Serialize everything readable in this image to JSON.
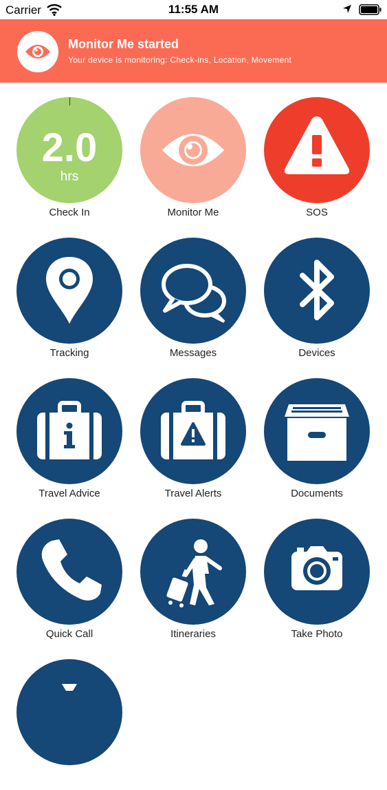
{
  "status_bar": {
    "carrier": "Carrier",
    "time": "11:55 AM"
  },
  "banner": {
    "title": "Monitor Me started",
    "subtitle": "Your device is monitoring: Check-ins, Location, Movement",
    "color": "#fb6b54"
  },
  "check_in": {
    "value": "2.0",
    "unit": "hrs",
    "label": "Check In",
    "color": "#a3d26e"
  },
  "tiles": [
    {
      "label": "Check In"
    },
    {
      "label": "Monitor Me",
      "icon": "eye-icon",
      "color": "#f9aa96"
    },
    {
      "label": "SOS",
      "icon": "warning-icon",
      "color": "#ee3e2b"
    },
    {
      "label": "Tracking",
      "icon": "map-pin-icon",
      "color": "#154777"
    },
    {
      "label": "Messages",
      "icon": "chat-bubbles-icon",
      "color": "#154777"
    },
    {
      "label": "Devices",
      "icon": "bluetooth-icon",
      "color": "#154777"
    },
    {
      "label": "Travel Advice",
      "icon": "suitcase-info-icon",
      "color": "#154777"
    },
    {
      "label": "Travel Alerts",
      "icon": "suitcase-alert-icon",
      "color": "#154777"
    },
    {
      "label": "Documents",
      "icon": "archive-box-icon",
      "color": "#154777"
    },
    {
      "label": "Quick Call",
      "icon": "phone-icon",
      "color": "#154777"
    },
    {
      "label": "Itineraries",
      "icon": "traveler-icon",
      "color": "#154777"
    },
    {
      "label": "Take Photo",
      "icon": "camera-icon",
      "color": "#154777"
    }
  ]
}
